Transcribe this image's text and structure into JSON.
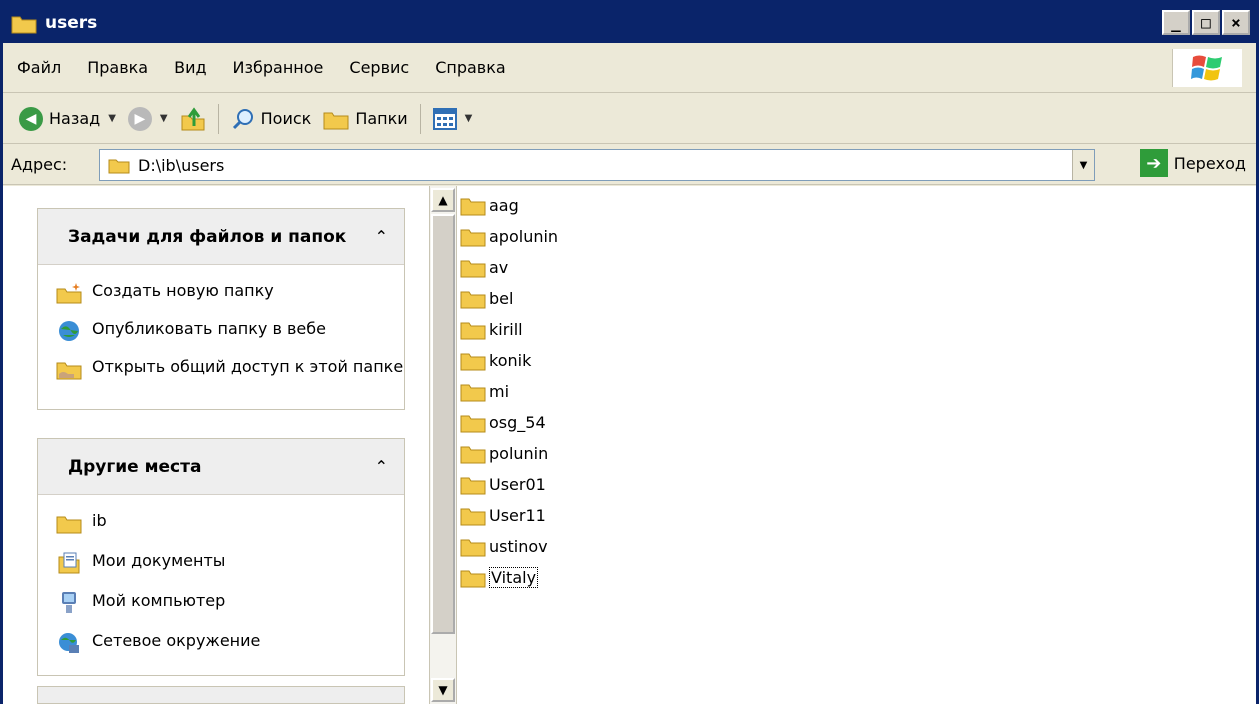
{
  "window": {
    "title": "users"
  },
  "title_controls": {
    "minimize": "_",
    "maximize": "□",
    "close": "×"
  },
  "menu": [
    "Файл",
    "Правка",
    "Вид",
    "Избранное",
    "Сервис",
    "Справка"
  ],
  "toolbar": {
    "back_label": "Назад",
    "search_label": "Поиск",
    "folders_label": "Папки"
  },
  "address": {
    "label": "Адрес:",
    "value": "D:\\ib\\users",
    "go_label": "Переход"
  },
  "tasks_panel": {
    "title": "Задачи для файлов и папок",
    "items": [
      {
        "label": "Создать новую папку",
        "icon": "new-folder-icon"
      },
      {
        "label": "Опубликовать папку в вебе",
        "icon": "web-publish-icon"
      },
      {
        "label": "Открыть общий доступ к этой папке",
        "icon": "share-folder-icon"
      }
    ]
  },
  "places_panel": {
    "title": "Другие места",
    "items": [
      {
        "label": "ib",
        "icon": "folder-icon"
      },
      {
        "label": "Мои документы",
        "icon": "my-documents-icon"
      },
      {
        "label": "Мой компьютер",
        "icon": "my-computer-icon"
      },
      {
        "label": "Сетевое окружение",
        "icon": "network-icon"
      }
    ]
  },
  "files": [
    "aag",
    "apolunin",
    "av",
    "bel",
    "kirill",
    "konik",
    "mi",
    "osg_54",
    "polunin",
    "User01",
    "User11",
    "ustinov",
    "Vitaly"
  ],
  "colors": {
    "title_bar": "#0a246a",
    "folder": "#f2c94c",
    "go_green": "#2f9c3a"
  }
}
